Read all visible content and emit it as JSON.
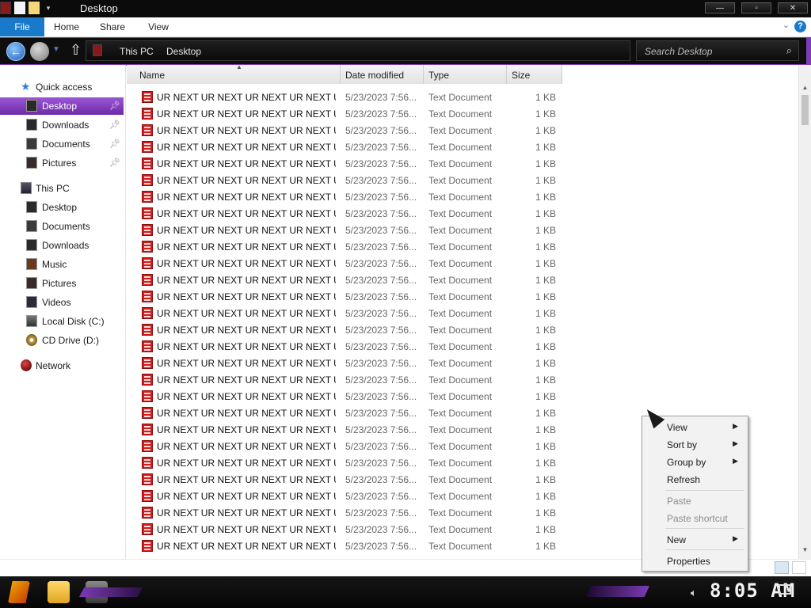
{
  "window": {
    "title": "Desktop"
  },
  "ribbon": {
    "tabs": [
      "File",
      "Home",
      "Share",
      "View"
    ],
    "help": "?"
  },
  "nav": {
    "breadcrumb": [
      "This PC",
      "Desktop"
    ],
    "search_placeholder": "Search Desktop"
  },
  "sidebar": {
    "quick_access": {
      "label": "Quick access",
      "items": [
        {
          "label": "Desktop",
          "pinned": true,
          "selected": true
        },
        {
          "label": "Downloads",
          "pinned": true
        },
        {
          "label": "Documents",
          "pinned": true
        },
        {
          "label": "Pictures",
          "pinned": true
        }
      ]
    },
    "this_pc": {
      "label": "This PC",
      "items": [
        {
          "label": "Desktop"
        },
        {
          "label": "Documents"
        },
        {
          "label": "Downloads"
        },
        {
          "label": "Music"
        },
        {
          "label": "Pictures"
        },
        {
          "label": "Videos"
        },
        {
          "label": "Local Disk (C:)"
        },
        {
          "label": "CD Drive (D:)"
        }
      ]
    },
    "network": {
      "label": "Network"
    }
  },
  "columns": [
    "Name",
    "Date modified",
    "Type",
    "Size"
  ],
  "files": {
    "name": "UR NEXT UR NEXT UR NEXT UR NEXT UR NEXT UR NE...",
    "date_modified": "5/23/2023 7:56...",
    "type": "Text Document",
    "size": "1 KB",
    "visible_rows": 28
  },
  "context_menu": {
    "items": [
      {
        "label": "View",
        "submenu": true
      },
      {
        "label": "Sort by",
        "submenu": true
      },
      {
        "label": "Group by",
        "submenu": true
      },
      {
        "label": "Refresh"
      },
      {
        "label": "Paste",
        "disabled": true
      },
      {
        "label": "Paste shortcut",
        "disabled": true
      },
      {
        "label": "New",
        "submenu": true
      },
      {
        "label": "Properties"
      }
    ]
  },
  "taskbar": {
    "clock": "8:05 AM"
  },
  "colors": {
    "accent": "#7d3bb5",
    "file_accent": "#1979ca",
    "file_icon": "#d71a1a"
  },
  "icons": [
    "back-icon",
    "forward-icon",
    "up-icon",
    "search-icon",
    "star-icon",
    "pin-icon",
    "folder-icon",
    "computer-icon",
    "network-icon",
    "text-file-icon",
    "volume-icon",
    "notification-icon"
  ]
}
